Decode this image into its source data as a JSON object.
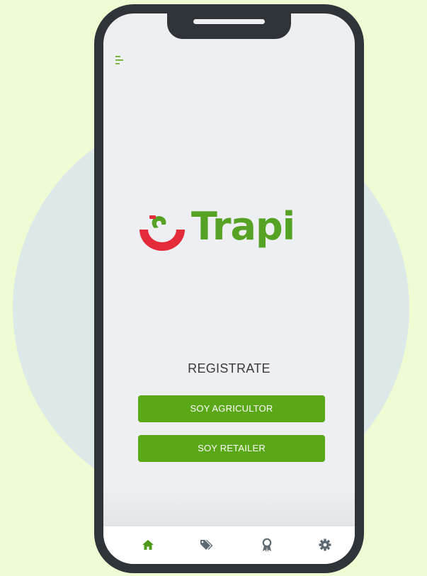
{
  "app": {
    "brand_name": "Trapi",
    "colors": {
      "primary_green": "#5aa817",
      "logo_green": "#55a224",
      "logo_red": "#e42b3a",
      "page_background": "#eefbd3"
    }
  },
  "header": {
    "menu_icon": "menu-icon"
  },
  "register": {
    "title": "REGISTRATE",
    "agricultor_label": "SOY AGRICULTOR",
    "retailer_label": "SOY RETAILER"
  },
  "tabbar": {
    "items": [
      {
        "icon": "home-icon",
        "active": true
      },
      {
        "icon": "tag-icon",
        "active": false
      },
      {
        "icon": "award-icon",
        "active": false
      },
      {
        "icon": "gear-icon",
        "active": false
      }
    ]
  }
}
